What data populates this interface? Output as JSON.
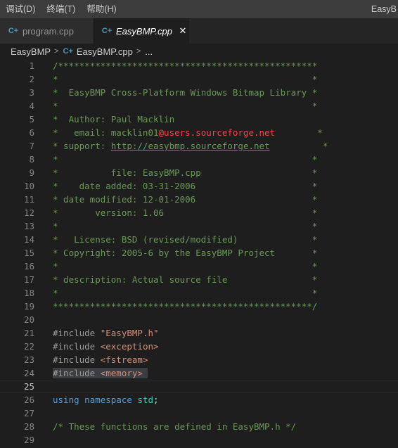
{
  "menubar": {
    "items": [
      "调试(D)",
      "终端(T)",
      "帮助(H)"
    ],
    "window_title": "EasyB"
  },
  "tabs": [
    {
      "label": "program.cpp",
      "icon": "cpp-file-icon",
      "active": false
    },
    {
      "label": "EasyBMP.cpp",
      "icon": "cpp-file-icon",
      "active": true,
      "close": "✕"
    }
  ],
  "breadcrumb": {
    "folder": "EasyBMP",
    "file": "EasyBMP.cpp",
    "more": "..."
  },
  "editor": {
    "current_line": 25,
    "lines": [
      {
        "n": "1",
        "segs": [
          [
            "c",
            "/*************************************************"
          ]
        ]
      },
      {
        "n": "2",
        "segs": [
          [
            "c",
            "*                                                *"
          ]
        ]
      },
      {
        "n": "3",
        "segs": [
          [
            "c",
            "*  EasyBMP Cross-Platform Windows Bitmap Library *"
          ]
        ]
      },
      {
        "n": "4",
        "segs": [
          [
            "c",
            "*                                                *"
          ]
        ]
      },
      {
        "n": "5",
        "segs": [
          [
            "c",
            "*  Author: Paul Macklin"
          ]
        ]
      },
      {
        "n": "6",
        "segs": [
          [
            "c",
            "*   email: macklin01"
          ],
          [
            "r",
            "@users.sourceforge.net"
          ],
          [
            "c",
            "        *"
          ]
        ]
      },
      {
        "n": "7",
        "segs": [
          [
            "c",
            "* support: "
          ],
          [
            "l",
            "http://easybmp.sourceforge.net"
          ],
          [
            "c",
            "          *"
          ]
        ]
      },
      {
        "n": "8",
        "segs": [
          [
            "c",
            "*                                                *"
          ]
        ]
      },
      {
        "n": "9",
        "segs": [
          [
            "c",
            "*          file: EasyBMP.cpp                     *"
          ]
        ]
      },
      {
        "n": "10",
        "segs": [
          [
            "c",
            "*    date added: 03-31-2006                      *"
          ]
        ]
      },
      {
        "n": "11",
        "segs": [
          [
            "c",
            "* date modified: 12-01-2006                      *"
          ]
        ]
      },
      {
        "n": "12",
        "segs": [
          [
            "c",
            "*       version: 1.06                            *"
          ]
        ]
      },
      {
        "n": "13",
        "segs": [
          [
            "c",
            "*                                                *"
          ]
        ]
      },
      {
        "n": "14",
        "segs": [
          [
            "c",
            "*   License: BSD (revised/modified)              *"
          ]
        ]
      },
      {
        "n": "15",
        "segs": [
          [
            "c",
            "* Copyright: 2005-6 by the EasyBMP Project       *"
          ]
        ]
      },
      {
        "n": "16",
        "segs": [
          [
            "c",
            "*                                                *"
          ]
        ]
      },
      {
        "n": "17",
        "segs": [
          [
            "c",
            "* description: Actual source file                *"
          ]
        ]
      },
      {
        "n": "18",
        "segs": [
          [
            "c",
            "*                                                *"
          ]
        ]
      },
      {
        "n": "19",
        "segs": [
          [
            "c",
            "*************************************************/"
          ]
        ]
      },
      {
        "n": "20",
        "segs": []
      },
      {
        "n": "21",
        "segs": [
          [
            "p",
            "#include "
          ],
          [
            "s",
            "\"EasyBMP.h\""
          ]
        ]
      },
      {
        "n": "22",
        "segs": [
          [
            "p",
            "#include "
          ],
          [
            "s",
            "<exception>"
          ]
        ]
      },
      {
        "n": "23",
        "segs": [
          [
            "p",
            "#include "
          ],
          [
            "s",
            "<fstream>"
          ]
        ]
      },
      {
        "n": "24",
        "segs": [
          [
            "h",
            "#include "
          ],
          [
            "hs",
            "<memory>"
          ],
          [
            "h",
            " "
          ]
        ]
      },
      {
        "n": "25",
        "segs": []
      },
      {
        "n": "26",
        "segs": [
          [
            "k",
            "using"
          ],
          [
            "t",
            " "
          ],
          [
            "k",
            "namespace"
          ],
          [
            "t",
            " "
          ],
          [
            "y",
            "std"
          ],
          [
            "t",
            ";"
          ]
        ]
      },
      {
        "n": "27",
        "segs": []
      },
      {
        "n": "28",
        "segs": [
          [
            "c",
            "/* These functions are defined in EasyBMP.h */"
          ]
        ]
      },
      {
        "n": "29",
        "segs": []
      }
    ]
  },
  "colors": {
    "comment": "#6a9955",
    "keyword": "#569cd6",
    "string": "#ce9178",
    "error_red": "#f44747",
    "cpp_icon": "#519aba"
  }
}
